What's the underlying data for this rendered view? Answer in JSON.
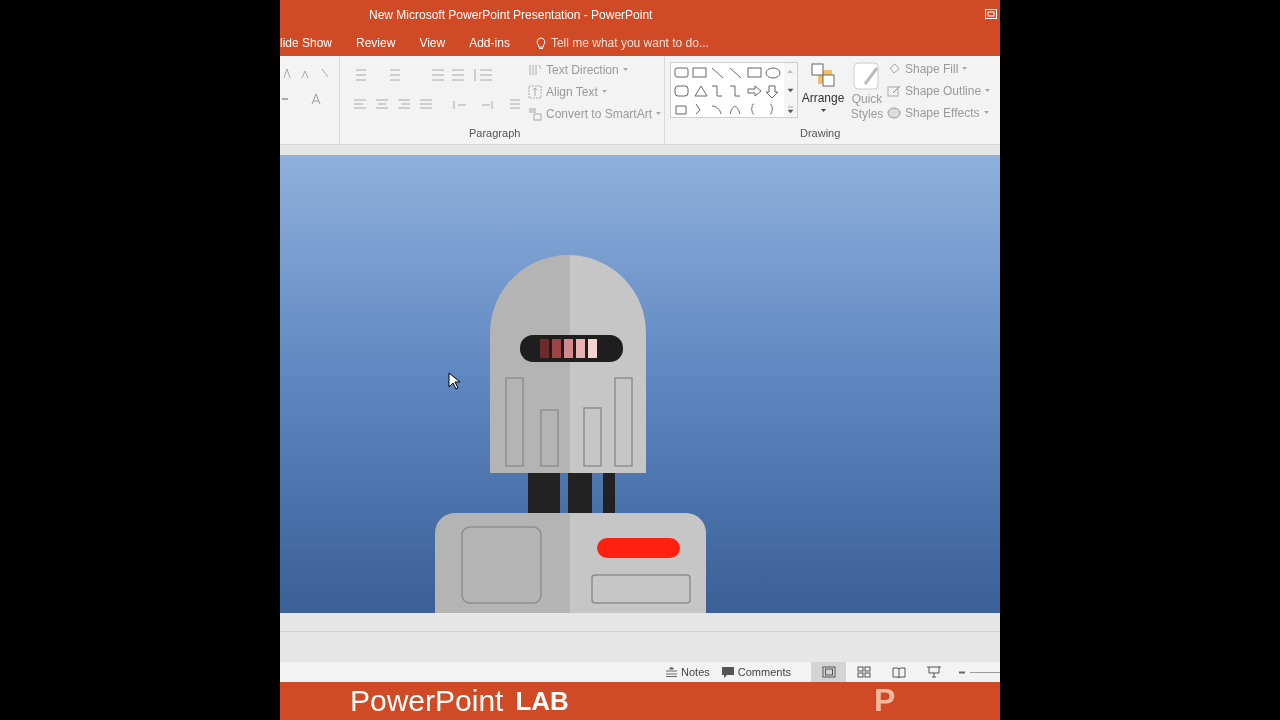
{
  "window": {
    "title": "New Microsoft PowerPoint Presentation - PowerPoint"
  },
  "tabs": [
    {
      "label": "lide Show",
      "selected": false
    },
    {
      "label": "Review",
      "selected": false
    },
    {
      "label": "View",
      "selected": false
    },
    {
      "label": "Add-ins",
      "selected": false
    }
  ],
  "tell_me": {
    "placeholder": "Tell me what you want to do..."
  },
  "ribbon": {
    "groups": [
      {
        "label": "Paragraph"
      },
      {
        "label": "Drawing"
      }
    ],
    "paragraph_commands": [
      {
        "label": "Text Direction",
        "disabled": true
      },
      {
        "label": "Align Text",
        "disabled": true
      },
      {
        "label": "Convert to SmartArt",
        "disabled": true
      }
    ],
    "arrange": {
      "label": "Arrange",
      "disabled": false
    },
    "quick_styles": {
      "label_1": "Quick",
      "label_2": "Styles",
      "disabled": true
    },
    "shape_commands": [
      {
        "label": "Shape Fill",
        "disabled": true
      },
      {
        "label": "Shape Outline",
        "disabled": true
      },
      {
        "label": "Shape Effects",
        "disabled": true
      }
    ]
  },
  "status_bar": {
    "buttons": [
      {
        "kind": "notes",
        "label": "Notes"
      },
      {
        "kind": "comments",
        "label": "Comments"
      }
    ],
    "views": [
      {
        "kind": "normal",
        "selected": true
      },
      {
        "kind": "sorter",
        "selected": false
      },
      {
        "kind": "reading",
        "selected": false
      },
      {
        "kind": "slideshow",
        "selected": false
      }
    ]
  },
  "banner": {
    "title": "PowerPoint",
    "subtitle": "LAB",
    "logo": "P"
  }
}
